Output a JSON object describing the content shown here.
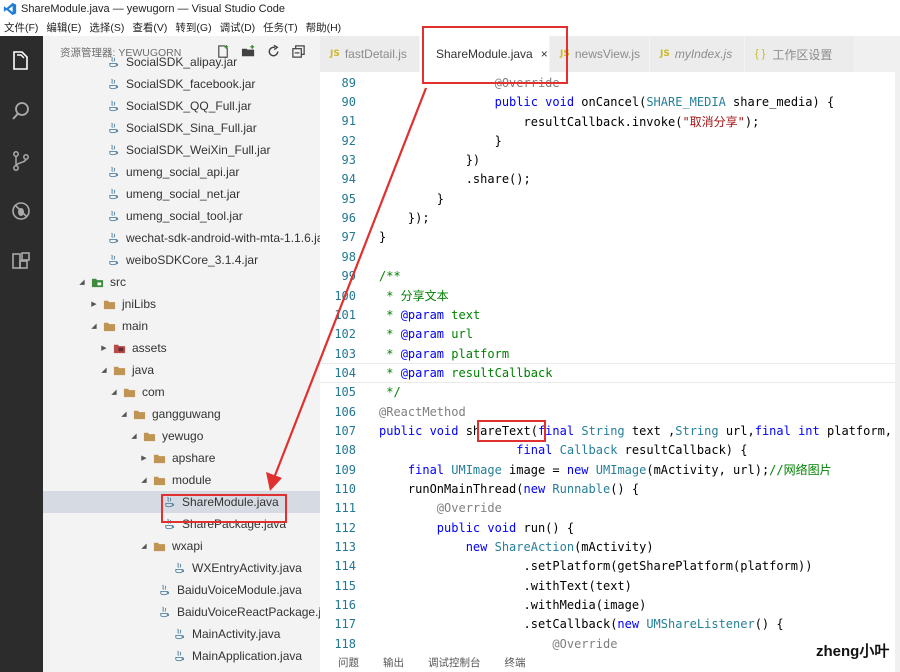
{
  "window": {
    "title": "ShareModule.java — yewugorn — Visual Studio Code"
  },
  "menu": [
    "文件(F)",
    "编辑(E)",
    "选择(S)",
    "查看(V)",
    "转到(G)",
    "调试(D)",
    "任务(T)",
    "帮助(H)"
  ],
  "activity": [
    "explorer-icon",
    "search-icon",
    "source-control-icon",
    "debug-icon",
    "extensions-icon"
  ],
  "sidebar": {
    "title": "资源管理器: YEWUGORN",
    "items": [
      {
        "label": "SocialSDK_alipay.jar",
        "icon": "jar"
      },
      {
        "label": "SocialSDK_facebook.jar",
        "icon": "jar"
      },
      {
        "label": "SocialSDK_QQ_Full.jar",
        "icon": "jar"
      },
      {
        "label": "SocialSDK_Sina_Full.jar",
        "icon": "jar"
      },
      {
        "label": "SocialSDK_WeiXin_Full.jar",
        "icon": "jar"
      },
      {
        "label": "umeng_social_api.jar",
        "icon": "jar"
      },
      {
        "label": "umeng_social_net.jar",
        "icon": "jar"
      },
      {
        "label": "umeng_social_tool.jar",
        "icon": "jar"
      },
      {
        "label": "wechat-sdk-android-with-mta-1.1.6.jar",
        "icon": "jar"
      },
      {
        "label": "weiboSDKCore_3.1.4.jar",
        "icon": "jar"
      },
      {
        "label": "src",
        "icon": "folder-green",
        "arrow": "open"
      },
      {
        "label": "jniLibs",
        "icon": "folder",
        "arrow": "closed"
      },
      {
        "label": "main",
        "icon": "folder",
        "arrow": "open"
      },
      {
        "label": "assets",
        "icon": "folder-red",
        "arrow": "closed"
      },
      {
        "label": "java",
        "icon": "folder",
        "arrow": "open"
      },
      {
        "label": "com",
        "icon": "folder",
        "arrow": "open"
      },
      {
        "label": "gangguwang",
        "icon": "folder",
        "arrow": "open"
      },
      {
        "label": "yewugo",
        "icon": "folder",
        "arrow": "open"
      },
      {
        "label": "apshare",
        "icon": "folder",
        "arrow": "closed"
      },
      {
        "label": "module",
        "icon": "folder",
        "arrow": "open"
      },
      {
        "label": "ShareModule.java",
        "icon": "java",
        "selected": true
      },
      {
        "label": "SharePackage.java",
        "icon": "java"
      },
      {
        "label": "wxapi",
        "icon": "folder",
        "arrow": "open"
      },
      {
        "label": "WXEntryActivity.java",
        "icon": "java"
      },
      {
        "label": "BaiduVoiceModule.java",
        "icon": "java"
      },
      {
        "label": "BaiduVoiceReactPackage.java",
        "icon": "java"
      },
      {
        "label": "MainActivity.java",
        "icon": "java"
      },
      {
        "label": "MainApplication.java",
        "icon": "java"
      }
    ]
  },
  "tabs": [
    {
      "label": "fastDetail.js",
      "kind": "js",
      "active": false
    },
    {
      "label": "ShareModule.java",
      "kind": "java",
      "active": true,
      "close": "×"
    },
    {
      "label": "newsView.js",
      "kind": "js",
      "active": false
    },
    {
      "label": "myIndex.js",
      "kind": "js",
      "active": false
    },
    {
      "label": "工作区设置",
      "kind": "settings",
      "active": false
    }
  ],
  "tab_js_badge": "JS",
  "tab_settings_badge": "{ }",
  "code": [
    {
      "n": "89",
      "t": [
        [
          "ann",
          "                @Override"
        ]
      ]
    },
    {
      "n": "90",
      "t": [
        [
          "kw",
          "                public void "
        ],
        [
          "",
          "onCancel("
        ],
        [
          "ty",
          "SHARE_MEDIA"
        ],
        [
          "",
          " share_media) {"
        ]
      ]
    },
    {
      "n": "91",
      "t": [
        [
          "",
          "                    resultCallback.invoke("
        ],
        [
          "str",
          "\"取消分享\""
        ],
        [
          "",
          ");"
        ]
      ]
    },
    {
      "n": "92",
      "t": [
        [
          "",
          "                }"
        ]
      ]
    },
    {
      "n": "93",
      "t": [
        [
          "",
          "            })"
        ]
      ]
    },
    {
      "n": "94",
      "t": [
        [
          "",
          "            .share();"
        ]
      ]
    },
    {
      "n": "95",
      "t": [
        [
          "",
          "        }"
        ]
      ]
    },
    {
      "n": "96",
      "t": [
        [
          "",
          "    });"
        ]
      ]
    },
    {
      "n": "97",
      "t": [
        [
          "",
          "}"
        ]
      ]
    },
    {
      "n": "98",
      "t": [
        [
          "",
          ""
        ]
      ]
    },
    {
      "n": "99",
      "t": [
        [
          "cm",
          "/**"
        ]
      ]
    },
    {
      "n": "100",
      "t": [
        [
          "cm",
          " * 分享文本"
        ]
      ]
    },
    {
      "n": "101",
      "t": [
        [
          "cm",
          " * "
        ],
        [
          "tag",
          "@param"
        ],
        [
          "cm",
          " text"
        ]
      ]
    },
    {
      "n": "102",
      "t": [
        [
          "cm",
          " * "
        ],
        [
          "tag",
          "@param"
        ],
        [
          "cm",
          " url"
        ]
      ]
    },
    {
      "n": "103",
      "t": [
        [
          "cm",
          " * "
        ],
        [
          "tag",
          "@param"
        ],
        [
          "cm",
          " platform"
        ]
      ]
    },
    {
      "n": "104",
      "t": [
        [
          "cm",
          " * "
        ],
        [
          "tag",
          "@param"
        ],
        [
          "cm",
          " resultCallback"
        ]
      ],
      "current": true
    },
    {
      "n": "105",
      "t": [
        [
          "cm",
          " */"
        ]
      ]
    },
    {
      "n": "106",
      "t": [
        [
          "ann",
          "@ReactMethod"
        ]
      ]
    },
    {
      "n": "107",
      "t": [
        [
          "kw",
          "public void "
        ],
        [
          "",
          "shareText("
        ],
        [
          "kw",
          "final "
        ],
        [
          "ty",
          "String"
        ],
        [
          "",
          " text ,"
        ],
        [
          "ty",
          "String"
        ],
        [
          "",
          " url,"
        ],
        [
          "kw",
          "final int"
        ],
        [
          "",
          " platform,"
        ]
      ]
    },
    {
      "n": "108",
      "t": [
        [
          "kw",
          "                   final "
        ],
        [
          "ty",
          "Callback"
        ],
        [
          "",
          " resultCallback) {"
        ]
      ]
    },
    {
      "n": "109",
      "t": [
        [
          "kw",
          "    final "
        ],
        [
          "ty",
          "UMImage"
        ],
        [
          "",
          " image = "
        ],
        [
          "kw",
          "new "
        ],
        [
          "ty",
          "UMImage"
        ],
        [
          "",
          "(mActivity, url);"
        ],
        [
          "cm",
          "//网络图片"
        ]
      ]
    },
    {
      "n": "110",
      "t": [
        [
          "",
          "    runOnMainThread("
        ],
        [
          "kw",
          "new "
        ],
        [
          "ty",
          "Runnable"
        ],
        [
          "",
          "() {"
        ]
      ]
    },
    {
      "n": "111",
      "t": [
        [
          "ann",
          "        @Override"
        ]
      ]
    },
    {
      "n": "112",
      "t": [
        [
          "kw",
          "        public void "
        ],
        [
          "",
          "run() {"
        ]
      ]
    },
    {
      "n": "113",
      "t": [
        [
          "kw",
          "            new "
        ],
        [
          "ty",
          "ShareAction"
        ],
        [
          "",
          "(mActivity)"
        ]
      ]
    },
    {
      "n": "114",
      "t": [
        [
          "",
          "                    .setPlatform(getSharePlatform(platform))"
        ]
      ]
    },
    {
      "n": "115",
      "t": [
        [
          "",
          "                    .withText(text)"
        ]
      ]
    },
    {
      "n": "116",
      "t": [
        [
          "",
          "                    .withMedia(image)"
        ]
      ]
    },
    {
      "n": "117",
      "t": [
        [
          "",
          "                    .setCallback("
        ],
        [
          "kw",
          "new "
        ],
        [
          "ty",
          "UMShareListener"
        ],
        [
          "",
          "() {"
        ]
      ]
    },
    {
      "n": "118",
      "t": [
        [
          "ann",
          "                        @Override"
        ]
      ]
    }
  ],
  "panel": [
    "问题",
    "输出",
    "调试控制台",
    "终端"
  ],
  "watermark": "zheng小叶",
  "colors": {
    "accent_red": "#e03030",
    "activity_bg": "#2c2c2c",
    "sidebar_bg": "#f3f3f3",
    "selection": "#d6dbe3"
  }
}
